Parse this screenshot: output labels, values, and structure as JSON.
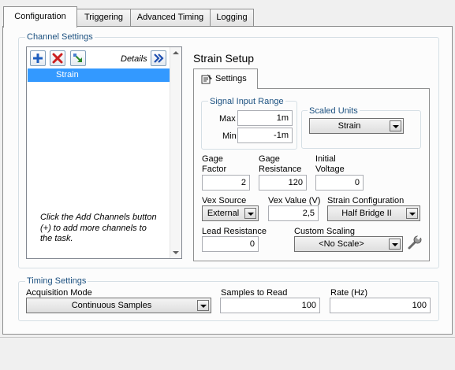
{
  "tabs": [
    "Configuration",
    "Triggering",
    "Advanced Timing",
    "Logging"
  ],
  "channel_settings": {
    "title": "Channel Settings",
    "details_label": "Details",
    "channels": [
      "Strain"
    ],
    "hint": "Click the Add Channels button (+) to add more channels to the task."
  },
  "strain_setup": {
    "title": "Strain Setup",
    "settings_tab": "Settings",
    "signal_input_range": {
      "title": "Signal Input Range",
      "max_label": "Max",
      "max_value": "1m",
      "min_label": "Min",
      "min_value": "-1m"
    },
    "scaled_units": {
      "title": "Scaled Units",
      "value": "Strain"
    },
    "gage_factor": {
      "label_1": "Gage",
      "label_2": "Factor",
      "value": "2"
    },
    "gage_resistance": {
      "label_1": "Gage",
      "label_2": "Resistance",
      "value": "120"
    },
    "initial_voltage": {
      "label_1": "Initial",
      "label_2": "Voltage",
      "value": "0"
    },
    "vex_source": {
      "label": "Vex Source",
      "value": "External"
    },
    "vex_value": {
      "label": "Vex Value (V)",
      "value": "2,5"
    },
    "strain_configuration": {
      "label": "Strain Configuration",
      "value": "Half Bridge II"
    },
    "lead_resistance": {
      "label": "Lead Resistance",
      "value": "0"
    },
    "custom_scaling": {
      "label": "Custom Scaling",
      "value": "<No Scale>"
    }
  },
  "timing_settings": {
    "title": "Timing Settings",
    "acquisition_mode": {
      "label": "Acquisition Mode",
      "value": "Continuous Samples"
    },
    "samples_to_read": {
      "label": "Samples to Read",
      "value": "100"
    },
    "rate": {
      "label": "Rate (Hz)",
      "value": "100"
    }
  },
  "icons": {
    "add": "plus-icon",
    "remove": "red-x-icon",
    "move": "arrow-icon",
    "details": "double-chevron-right-icon",
    "settings": "settings-tab-icon",
    "scaling": "wrench-icon"
  },
  "colors": {
    "selection": "#3399ff",
    "group_title": "#1c5180",
    "add_blue": "#1f5fbf",
    "remove_red": "#cc2020"
  }
}
